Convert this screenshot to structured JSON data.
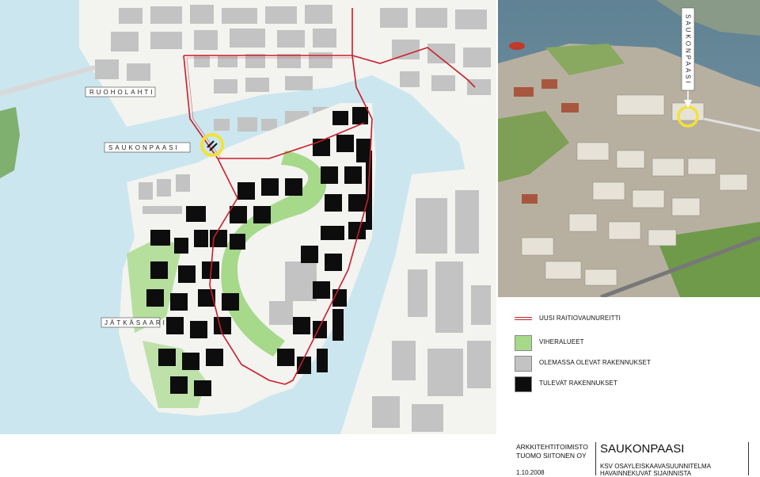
{
  "map": {
    "labels": {
      "ruoholahti": "RUOHOLAHTI",
      "saukonpaasi": "SAUKONPAASI",
      "jatkasaari": "JÄTKÄSAARI"
    },
    "colors": {
      "water": "#cbe6ee",
      "land": "#f3f3f0",
      "green": "#a6d98a",
      "existing": "#c3c3c3",
      "planned": "#0d0d0d",
      "tram": "#c91e2a",
      "marker": "#f2e23a"
    }
  },
  "aerial": {
    "vertical_label": "SAUKONPAASI"
  },
  "legend": [
    {
      "kind": "line",
      "color": "#c91e2a",
      "label": "UUSI RAITIOVAUNUREITTI"
    },
    {
      "kind": "swatch",
      "color": "#a6d98a",
      "label": "VIHERALUEET"
    },
    {
      "kind": "swatch",
      "color": "#c3c3c3",
      "label": "OLEMASSA OLEVAT RAKENNUKSET"
    },
    {
      "kind": "swatch",
      "color": "#0d0d0d",
      "label": "TULEVAT RAKENNUKSET"
    }
  ],
  "titleblock": {
    "office_line1": "ARKKITEHTITOIMISTO",
    "office_line2": "TUOMO SIITONEN OY",
    "date": "1.10.2008",
    "title": "SAUKONPAASI",
    "subtitle_line1": "KSV OSAYLEISKAAVASUUNNITELMA",
    "subtitle_line2": "HAVAINNEKUVAT SIJAINNISTA"
  }
}
